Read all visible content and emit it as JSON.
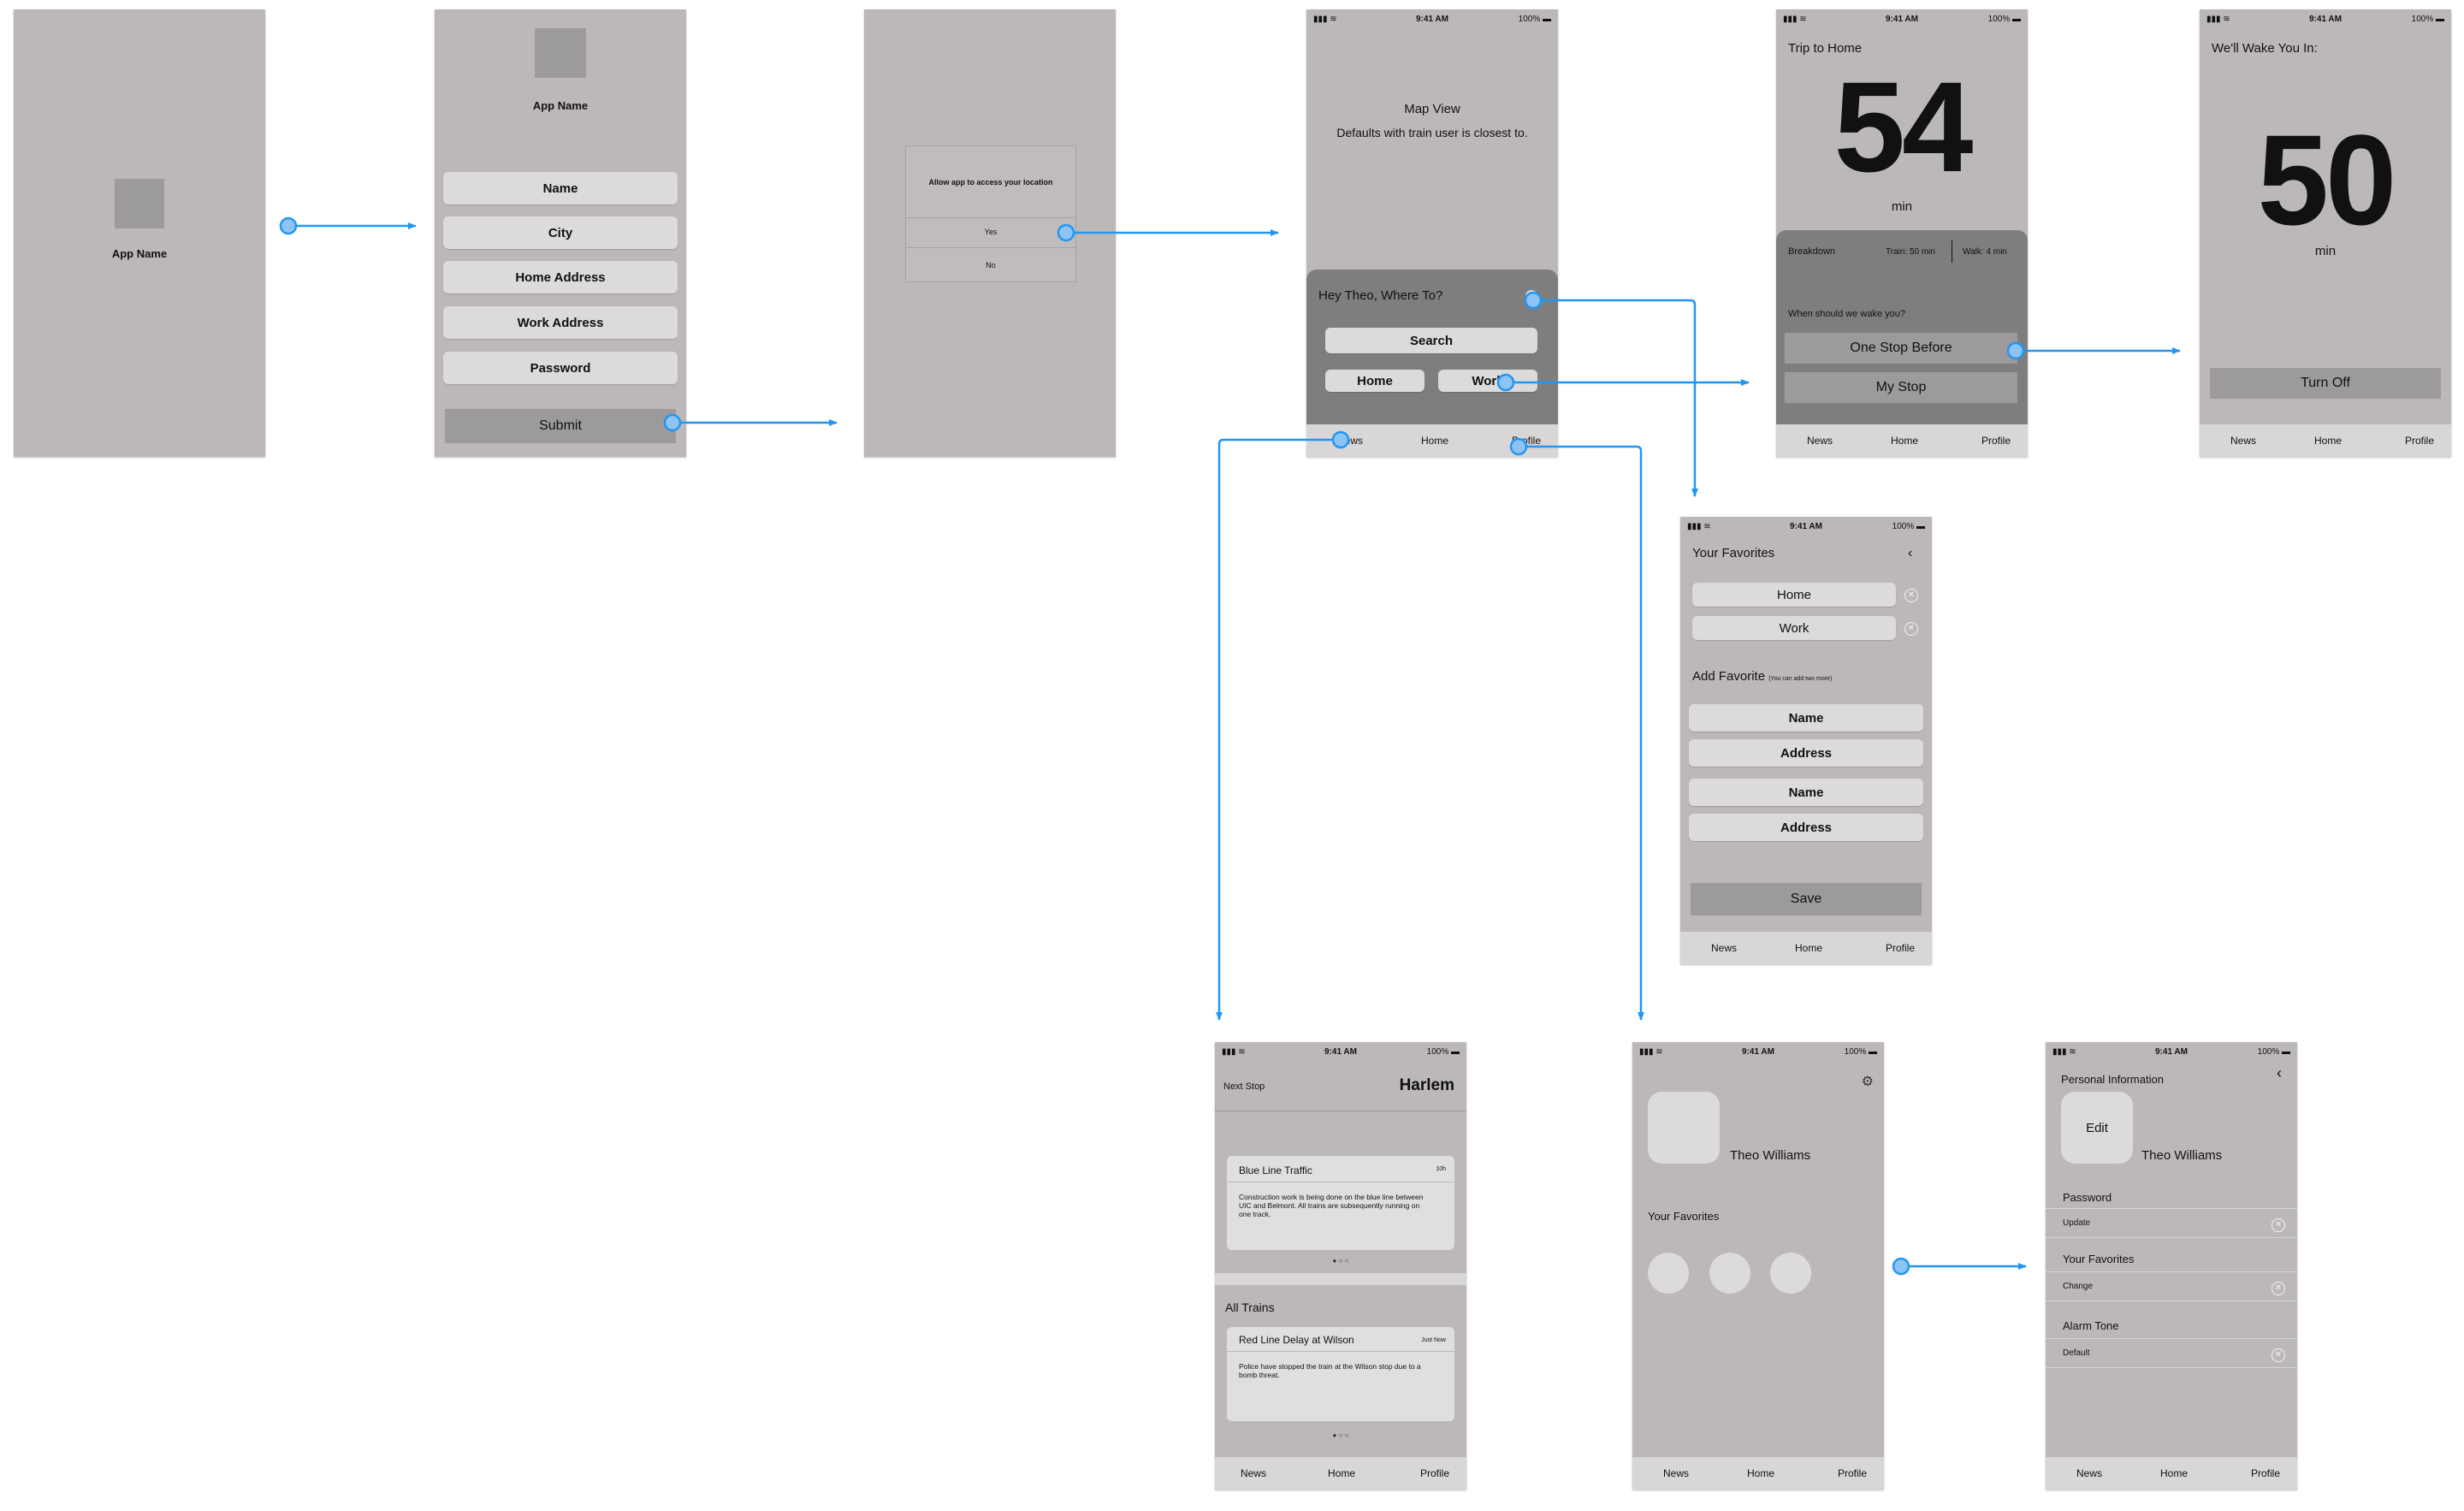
{
  "colors": {
    "screen": "#bcb8b7",
    "connector": "#2196f3",
    "tabbar": "#d8d6d6",
    "button_dark": "#9c9a9a"
  },
  "status_bar": {
    "time": "9:41 AM",
    "battery": "100%"
  },
  "tabs": {
    "news": "News",
    "home": "Home",
    "profile": "Profile"
  },
  "splash": {
    "app_name": "App Name"
  },
  "signup": {
    "app_name": "App Name",
    "fields": [
      "Name",
      "City",
      "Home Address",
      "Work Address",
      "Password"
    ],
    "submit": "Submit"
  },
  "permission": {
    "prompt": "Allow app to access your location",
    "yes": "Yes",
    "no": "No"
  },
  "map": {
    "title": "Map View",
    "subtitle": "Defaults with train user is closest to.",
    "greeting": "Hey Theo, Where To?",
    "search": "Search",
    "home": "Home",
    "work": "Work"
  },
  "trip": {
    "title": "Trip to Home",
    "minutes": "54",
    "unit": "min",
    "breakdown": "Breakdown",
    "train": "Train: 50 min",
    "walk": "Walk: 4 min",
    "question": "When should we wake you?",
    "option1": "One Stop Before",
    "option2": "My Stop"
  },
  "wake": {
    "title": "We'll Wake You In:",
    "minutes": "50",
    "unit": "min",
    "turn_off": "Turn Off"
  },
  "favorites": {
    "title": "Your Favorites",
    "items": [
      "Home",
      "Work"
    ],
    "add_title": "Add Favorite",
    "add_note": "(You can add two more)",
    "fields": [
      "Name",
      "Address",
      "Name",
      "Address"
    ],
    "save": "Save"
  },
  "news": {
    "next_stop_label": "Next Stop",
    "next_stop": "Harlem",
    "card1_title": "Blue Line Traffic",
    "card1_time": "10h",
    "card1_body": "Construction work is being done on the blue line between UIC and Belmont. All trains are subsequently running on one track.",
    "all_trains": "All Trains",
    "card2_title": "Red Line Delay at Wilson",
    "card2_time": "Just Now",
    "card2_body": "Police have stopped the train at the Wilson stop due to a bomb threat."
  },
  "profile": {
    "name": "Theo Williams",
    "favorites": "Your Favorites"
  },
  "settings": {
    "title": "Personal Information",
    "edit": "Edit",
    "name": "Theo Williams",
    "password": "Password",
    "update": "Update",
    "favorites": "Your Favorites",
    "change": "Change",
    "alarm": "Alarm Tone",
    "default": "Default"
  }
}
